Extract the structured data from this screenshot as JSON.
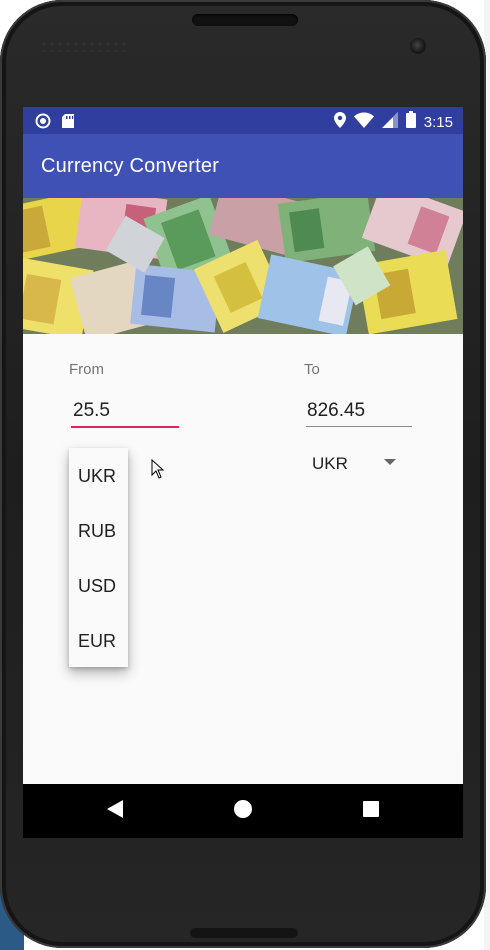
{
  "status_bar": {
    "time": "3:15",
    "icons": [
      "circle-notification-icon",
      "sd-card-icon",
      "location-icon",
      "wifi-icon",
      "signal-icon",
      "battery-icon"
    ]
  },
  "app": {
    "title": "Currency Converter",
    "primary_color": "#3f51b5",
    "primary_dark_color": "#303f9f",
    "accent_color": "#e91e63"
  },
  "banner": {
    "image": "euro-banknotes-banner"
  },
  "converter": {
    "from_label": "From",
    "from_value": "25.5",
    "to_label": "To",
    "to_value": "826.45",
    "to_currency": "UKR",
    "from_dropdown_options": [
      "UKR",
      "RUB",
      "USD",
      "EUR"
    ]
  },
  "nav_bar": {
    "buttons": [
      "back-icon",
      "home-icon",
      "recents-icon"
    ]
  }
}
